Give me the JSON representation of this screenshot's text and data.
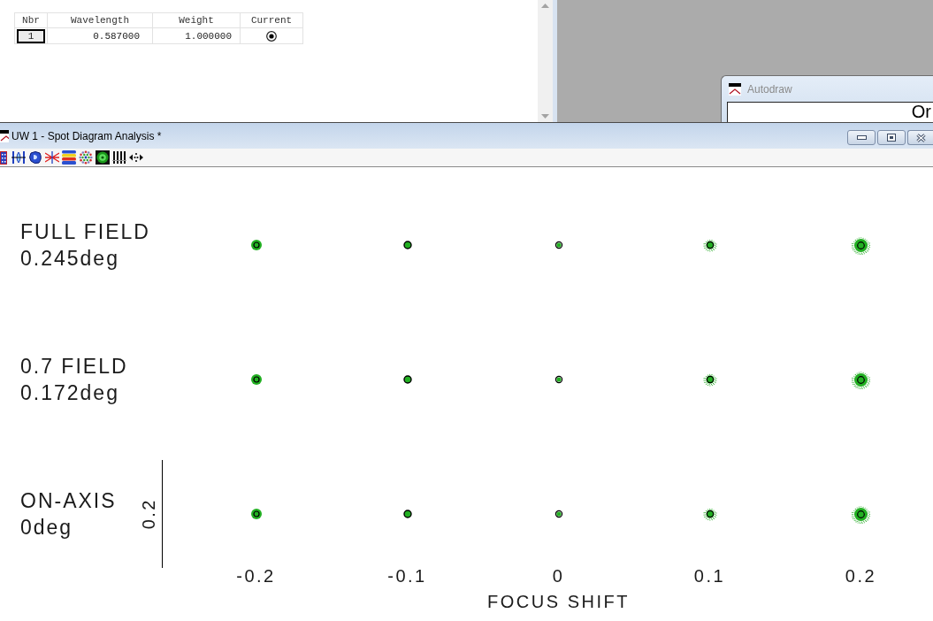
{
  "wavelength_table": {
    "columns": [
      "Nbr",
      "Wavelength",
      "Weight",
      "Current"
    ],
    "rows": [
      {
        "nbr": "1",
        "wavelength": "0.587000",
        "weight": "1.000000",
        "current": true,
        "selected": true
      }
    ]
  },
  "autodraw_window": {
    "title": "Autodraw",
    "active": false,
    "text": "Or"
  },
  "analysis_window": {
    "title": "UW 1 - Spot Diagram Analysis *",
    "active": true
  },
  "spot_diagram": {
    "rows": [
      {
        "field": "FULL FIELD",
        "angle": "0.245deg"
      },
      {
        "field": "0.7 FIELD",
        "angle": "0.172deg"
      },
      {
        "field": "ON-AXIS",
        "angle": "0deg"
      }
    ],
    "focus_shifts": [
      "-0.2",
      "-0.1",
      "0",
      "0.1",
      "0.2"
    ],
    "x_axis_title": "FOCUS SHIFT",
    "scale_label": "0.2"
  }
}
